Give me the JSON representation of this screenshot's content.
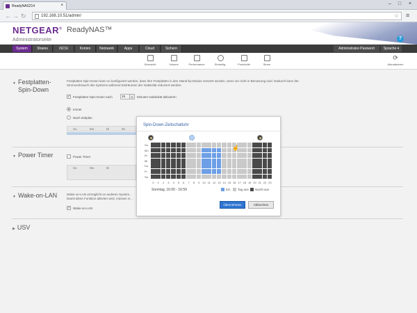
{
  "browser": {
    "tab_title": "ReadyNAS214",
    "url": "192.168.10.51/admin/"
  },
  "header": {
    "brand": "NETGEAR",
    "brand_suffix": "®",
    "product": "ReadyNAS™",
    "subtitle": "Administratorseite"
  },
  "nav": {
    "tabs": [
      "System",
      "Shares",
      "iSCSI",
      "Konten",
      "Netzwerk",
      "Apps",
      "Cloud",
      "Sichern"
    ],
    "active_tab": "System",
    "admin_password": "Administrator-Passwort",
    "language": "Sprache ▾"
  },
  "toolbar": {
    "items": [
      "Übersicht",
      "Volume",
      "Performance",
      "Einstellg.",
      "Protokolle",
      "Strom"
    ],
    "refresh": "Aktualisieren"
  },
  "sections": {
    "spin_down": {
      "title_line1": "Festplatten-",
      "title_line2": "Spin-Down",
      "desc": "Festplatten-Spin-Down kann so konfiguriert werden, dass Ihre Festplatten in den Stand-by-Modus versetzt werden, wenn sie nicht in Benutzung sind. Dadurch kann der Stromverbrauch des Systems während Zeiträumen der Inaktivität reduziert werden.",
      "checkbox_label": "Festplatten-Spin-Down nach",
      "minutes_value": "15",
      "minutes_suffix": "Minuten Inaktivität aktivieren",
      "radio_always": "Immer",
      "radio_schedule": "Nach Zeitplan",
      "days": [
        "So",
        "Mo",
        "Di",
        "Mi"
      ]
    },
    "power_timer": {
      "title": "Power Timer",
      "checkbox_label": "Power Timer",
      "days": [
        "So",
        "Mo",
        "Di"
      ]
    },
    "wol": {
      "title": "Wake-on-LAN",
      "desc_line1": "Wake-on-LAN ermöglicht es anderen System...",
      "desc_line2": "Damit diese Funktion aktiviert wird, müssen S...",
      "checkbox_label": "Wake-on-LAN"
    },
    "usv": {
      "title": "USV"
    }
  },
  "dialog": {
    "title": "Spin-Down-Zeitschaltuhr",
    "day_labels": [
      "So",
      "Mo",
      "Di",
      "Mi",
      "Do",
      "Fr",
      "Sa"
    ],
    "hours": [
      "0",
      "1",
      "2",
      "3",
      "4",
      "5",
      "6",
      "7",
      "8",
      "9",
      "10",
      "11",
      "12",
      "13",
      "14",
      "15",
      "16",
      "17",
      "18",
      "19",
      "20",
      "21",
      "22",
      "23"
    ],
    "status_text": "Sonntag, 16:00 - 16:59",
    "legend": {
      "on": "Ein",
      "day_off": "Tag aus",
      "night_off": "Nacht aus"
    },
    "ok_button": "Übernehmen",
    "cancel_button": "Abbrechen",
    "colors": {
      "night_off": "#4a4a4a",
      "day_off": "#c9c9c9",
      "on": "#6d9fe6"
    },
    "schedule": {
      "night_off_hours": [
        0,
        1,
        2,
        3,
        4,
        5,
        6,
        20,
        21,
        22,
        23
      ],
      "on_hours": [
        10,
        11,
        12,
        13
      ],
      "on_days": [
        "Mo",
        "Di",
        "Mi",
        "Do",
        "Fr"
      ]
    }
  }
}
